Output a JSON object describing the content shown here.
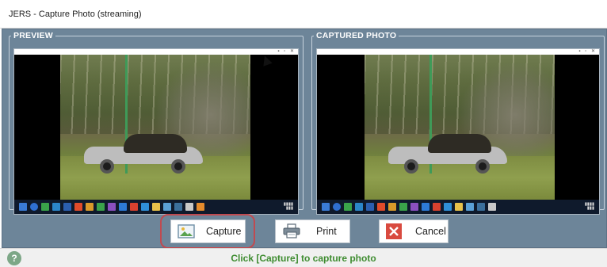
{
  "window": {
    "title": "JERS - Capture Photo (streaming)"
  },
  "preview": {
    "legend": "PREVIEW"
  },
  "captured": {
    "legend": "CAPTURED PHOTO"
  },
  "buttons": {
    "capture_label": "Capture",
    "print_label": "Print",
    "cancel_label": "Cancel"
  },
  "status": {
    "help_glyph": "?",
    "message": "Click [Capture] to capture photo"
  },
  "colors": {
    "body_bg": "#6d8599",
    "status_text": "#3e8c30",
    "highlight": "#c04a50",
    "cancel_red": "#d94a3f"
  }
}
